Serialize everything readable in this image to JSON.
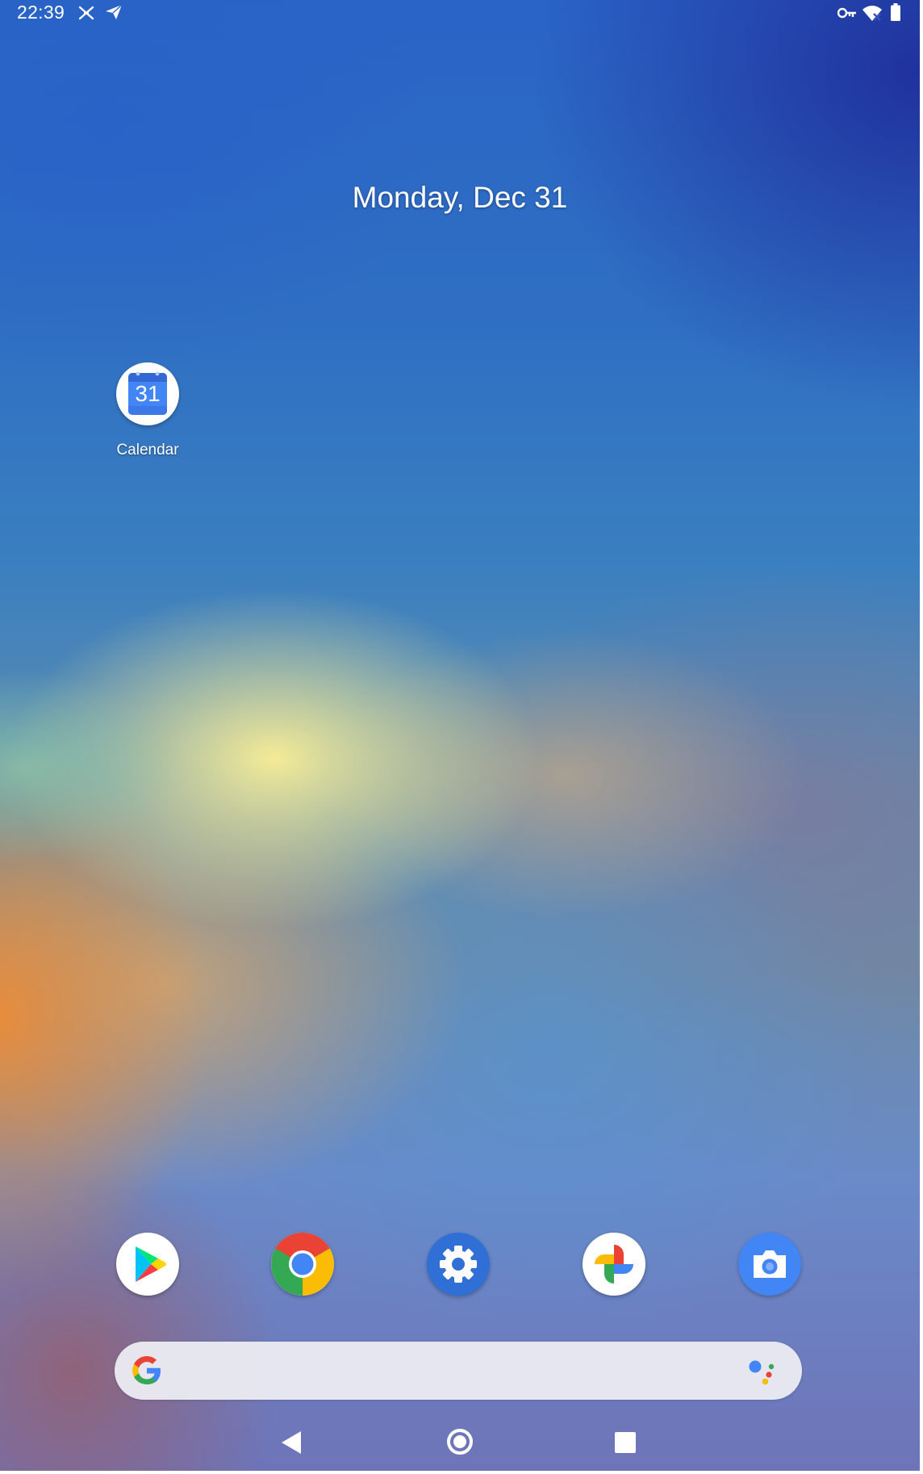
{
  "status_bar": {
    "time": "22:39",
    "left_icons": [
      "data-saver-icon",
      "send-icon"
    ],
    "right_icons": [
      "vpn-key-icon",
      "wifi-off-icon",
      "battery-icon"
    ]
  },
  "home": {
    "date": "Monday, Dec 31",
    "apps": [
      {
        "name": "calendar",
        "label": "Calendar",
        "icon_text": "31"
      }
    ]
  },
  "dock": {
    "apps": [
      "play-store-icon",
      "chrome-icon",
      "settings-icon",
      "photos-icon",
      "camera-icon"
    ]
  },
  "search_bar": {
    "placeholder": "",
    "left_icon": "google-g-icon",
    "right_icon": "google-assistant-icon"
  },
  "nav_bar": {
    "buttons": [
      "back-icon",
      "home-icon",
      "recents-icon"
    ]
  },
  "colors": {
    "google_blue": "#4285F4",
    "google_red": "#EA4335",
    "google_yellow": "#FBBC05",
    "google_green": "#34A853",
    "settings_blue": "#2f6fd6"
  }
}
